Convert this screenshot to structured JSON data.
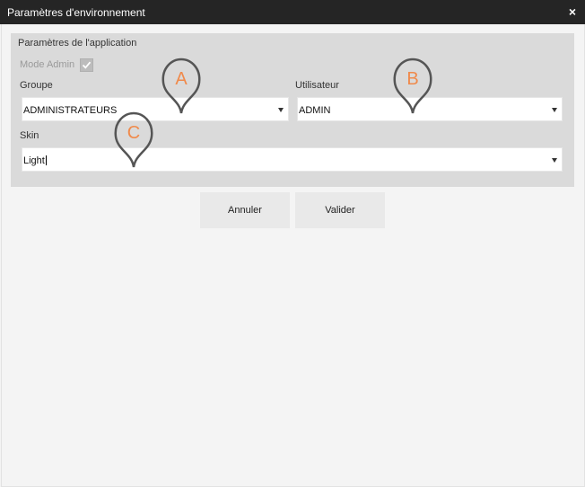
{
  "window": {
    "title": "Paramètres d'environnement",
    "close_label": "×"
  },
  "app_settings": {
    "group_title": "Paramètres de l'application",
    "mode_admin_label": "Mode Admin",
    "mode_admin_checked": true,
    "groupe": {
      "label": "Groupe",
      "value": "ADMINISTRATEURS",
      "icon": "dropdown-arrow-icon"
    },
    "utilisateur": {
      "label": "Utilisateur",
      "value": "ADMIN",
      "icon": "dropdown-arrow-icon"
    },
    "skin": {
      "label": "Skin",
      "value": "Light",
      "icon": "dropdown-arrow-icon"
    }
  },
  "buttons": {
    "cancel": "Annuler",
    "validate": "Valider"
  },
  "callouts": [
    {
      "letter": "A",
      "color": "#f08a4b"
    },
    {
      "letter": "B",
      "color": "#f08a4b"
    },
    {
      "letter": "C",
      "color": "#f08a4b"
    }
  ]
}
